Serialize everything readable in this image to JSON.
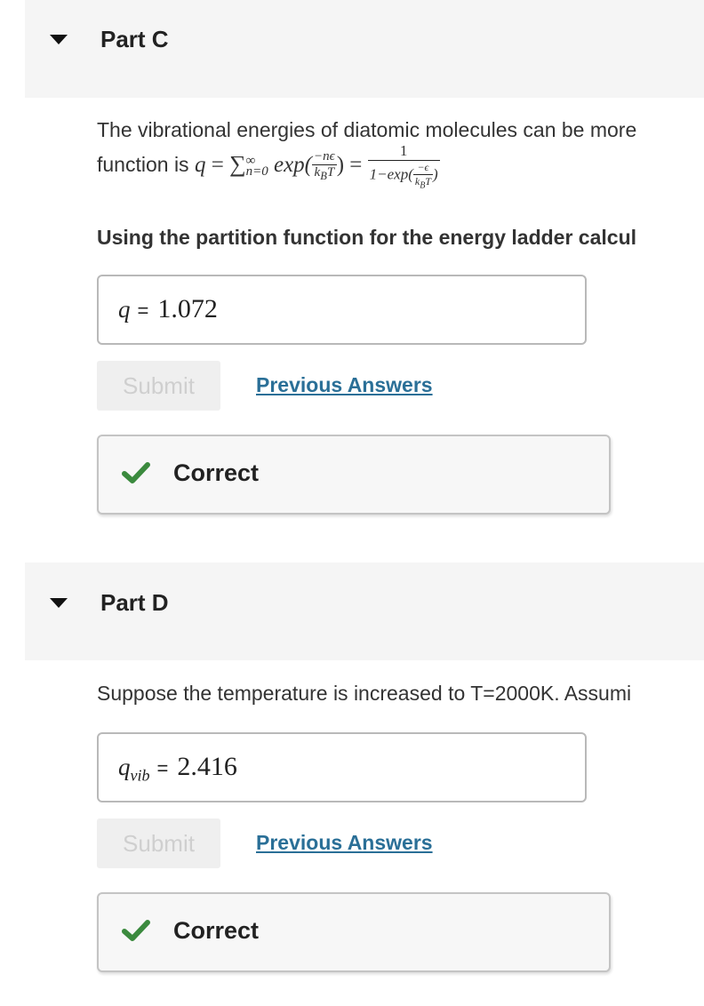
{
  "partC": {
    "title": "Part C",
    "prose_line1": "The vibrational energies of diatomic molecules can be more",
    "prose_line2_prefix": "function is",
    "formula": {
      "lhs": "q",
      "sum_upper": "∞",
      "sum_lower": "n=0",
      "exp_text": "exp(",
      "frac1_num": "−nϵ",
      "frac1_den": "k",
      "frac1_den_sub": "B",
      "frac1_den_T": "T",
      "rhs_num": "1",
      "rhs_den_prefix": "1−exp(",
      "rhs_inner_num": "−ϵ",
      "rhs_inner_den": "k",
      "rhs_inner_den_sub": "B",
      "rhs_inner_den_T": "T"
    },
    "question": "Using the partition function for the energy ladder calcul",
    "answer_label": "q",
    "answer_equals": "=",
    "answer_value": "1.072",
    "submit_label": "Submit",
    "previous_answers_label": "Previous Answers",
    "correct_label": "Correct"
  },
  "partD": {
    "title": "Part D",
    "prose": "Suppose the temperature is increased to T=2000K. Assumi",
    "answer_label": "q",
    "answer_label_sub": "vib",
    "answer_equals": "=",
    "answer_value": "2.416",
    "submit_label": "Submit",
    "previous_answers_label": "Previous Answers",
    "correct_label": "Correct"
  },
  "colors": {
    "check_green": "#3b8a3e",
    "link_blue": "#2a6f97"
  }
}
